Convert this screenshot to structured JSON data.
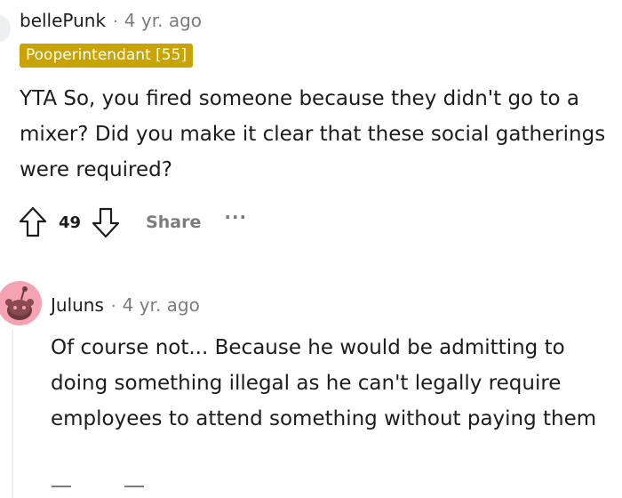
{
  "comment1": {
    "username": "bellePunk",
    "separator": "·",
    "timestamp": "4 yr. ago",
    "flair": "Pooperintendant [55]",
    "flair_color": "#c9a400",
    "body": "YTA So, you fired someone because they didn't go to a mixer? Did you make it clear that these social gatherings were required?",
    "votes": "49",
    "share_label": "Share",
    "more_label": "···",
    "upvote_icon": "upvote-arrow-icon",
    "downvote_icon": "downvote-arrow-icon"
  },
  "comment2": {
    "username": "Juluns",
    "separator": "·",
    "timestamp": "4 yr. ago",
    "avatar_color": "#f5a3b3",
    "body": "Of course not... Because he would be admitting to doing something illegal as he can't legally require employees to attend something without paying them"
  }
}
